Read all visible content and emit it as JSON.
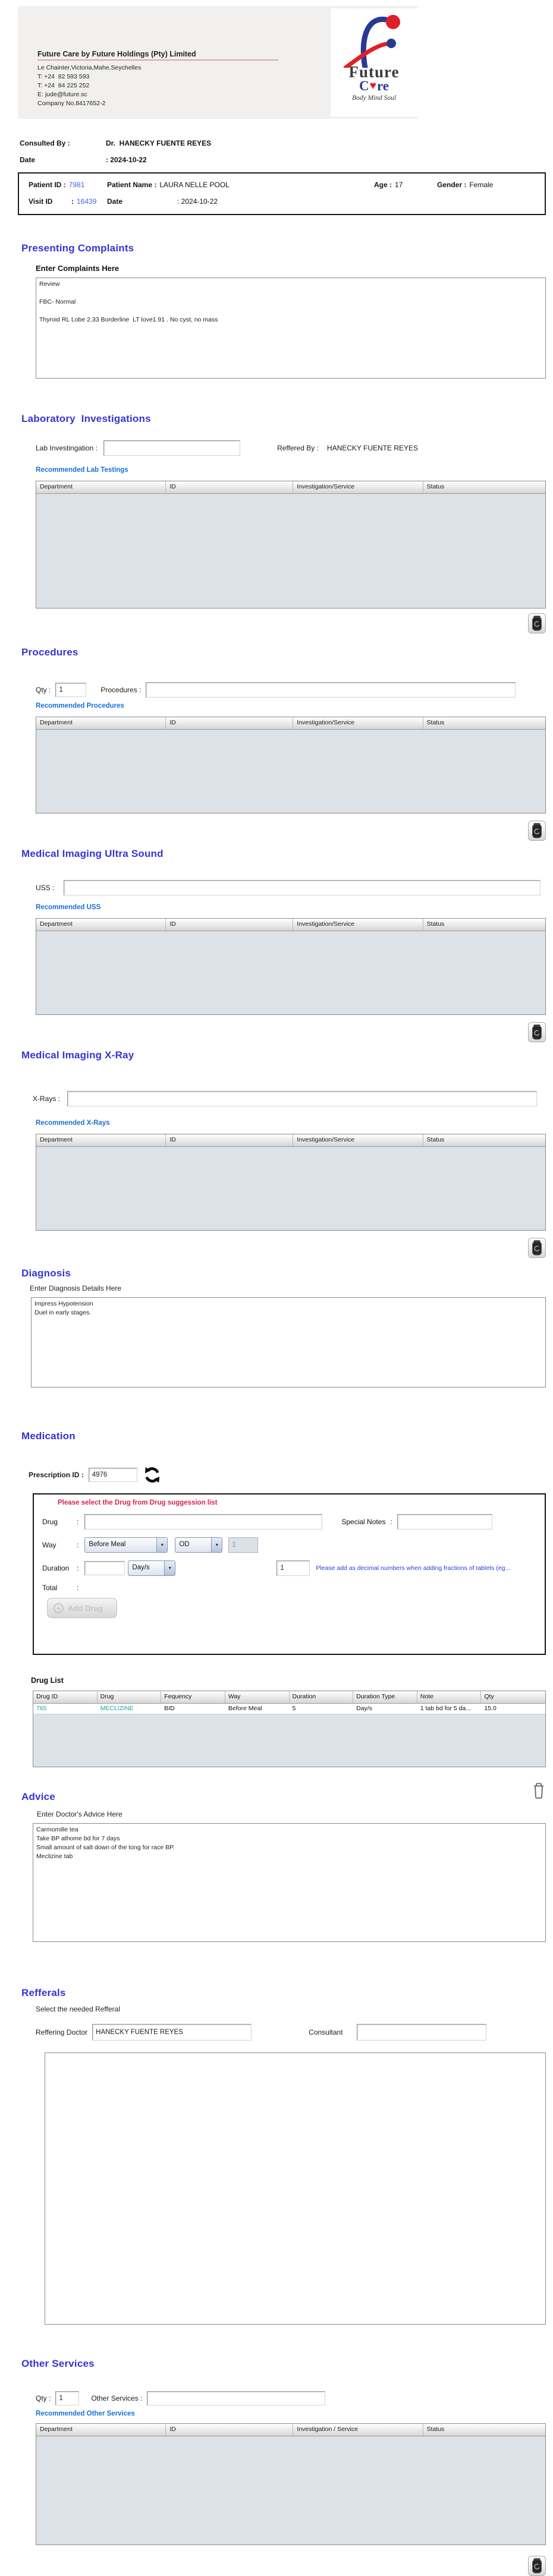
{
  "colon": ":",
  "icons": {
    "dropdown_arrow": "▼",
    "heart": "♥",
    "plus": "+"
  },
  "header": {
    "company_name": "Future Care by Future Holdings (Pty) Limited",
    "address_line": "Le Chainter,Victoria,Mahe,Seychelles",
    "phone1": "T: +24  82 593 593",
    "phone2": "T: +24  84 225 252",
    "email": "E: jude@future.sc",
    "company_no": "Company No.8417652-2",
    "logo_word_future": "Future",
    "logo_word_care_c": "C",
    "logo_word_care_re": "re",
    "logo_tagline": "Body Mind Soul"
  },
  "consultation": {
    "consulted_by_label": "Consulted By :",
    "consulted_by_value": "Dr.  HANECKY FUENTE REYES",
    "date_label": "Date",
    "date_value": ": 2024-10-22"
  },
  "patient": {
    "patient_id_label": "Patient ID :",
    "patient_id": "7981",
    "patient_name_label": "Patient Name :",
    "patient_name": "LAURA NELLE POOL",
    "age_label": "Age :",
    "age": "17",
    "gender_label": "Gender :",
    "gender": "Female",
    "visit_id_label": "Visit ID",
    "visit_id": "16439",
    "visit_date_label": "Date",
    "visit_date_value": ": 2024-10-22"
  },
  "complaints": {
    "title": "Presenting Complaints",
    "sub_label": "Enter Complaints Here",
    "text": "Review\n\nFBC- Normal\n\nThyroid RL Lobe 2.33 Borderline  LT love1.91 . No cyst, no mass"
  },
  "lab": {
    "title": "Laboratory  Investigations",
    "input_label": "Lab Investingation :",
    "input_value": "",
    "referred_by_label": "Reffered By :",
    "referred_by_value": "HANECKY FUENTE REYES",
    "link": "Recommended Lab Testings",
    "headers": [
      "Department",
      "ID",
      "Investigation/Service",
      "Status"
    ]
  },
  "procedures": {
    "title": "Procedures",
    "qty_label": "Qty :",
    "qty_value": "1",
    "input_label": "Procedures :",
    "input_value": "",
    "link": "Recommended Procedures",
    "headers": [
      "Department",
      "ID",
      "Investigation/Service",
      "Status"
    ]
  },
  "uss": {
    "title": "Medical Imaging Ultra Sound",
    "input_label": "USS :",
    "input_value": "",
    "link": "Recommended USS",
    "headers": [
      "Department",
      "ID",
      "Investigation/Service",
      "Status"
    ]
  },
  "xray": {
    "title": "Medical Imaging X-Ray",
    "input_label": "X-Rays :",
    "input_value": "",
    "link": "Recommended X-Rays",
    "headers": [
      "Department",
      "ID",
      "Investigation/Service",
      "Status"
    ]
  },
  "diagnosis": {
    "title": "Diagnosis",
    "sub_label": "Enter Diagnosis Details Here",
    "text": "Impress Hypotension\nDuel in early stages."
  },
  "medication": {
    "title": "Medication",
    "prescription_id_label": "Prescription ID :",
    "prescription_id": "4976",
    "warning": "Please select the Drug from Drug suggession list",
    "drug_label": "Drug",
    "drug_value": "",
    "special_notes_label": "Special Notes",
    "special_notes_value": "",
    "way_label": "Way",
    "way_value": "Before Meal",
    "frequency_value": "OD",
    "way_qty_value": "1",
    "duration_label": "Duration",
    "duration_value": "",
    "duration_unit_value": "Day/s",
    "tablet_qty_value": "1",
    "hint": "Please add as decimal numbers when adding fractions of tablets (eg...",
    "total_label": "Total",
    "add_drug_label": "Add Drug",
    "drug_list_title": "Drug List",
    "table": {
      "headers": [
        "Drug ID",
        "Drug",
        "Fequency",
        "Way",
        "Duration",
        "Duration Type",
        "Note",
        "Qty"
      ],
      "row": [
        "765",
        "MECLIZINE",
        "BID",
        "Before Meal",
        "5",
        "Day/s",
        "1 tab bd for 5 da...",
        "15.0"
      ]
    }
  },
  "advice": {
    "title": "Advice",
    "sub_label": "Enter Doctor's Advice Here",
    "text": "Carmomille tea\nTake BP athome bd for 7 days\nSmall amount of salt down of the tong for race BP.\nMeclizine tab"
  },
  "referrals": {
    "title": "Refferals",
    "sub_label": "Select the needed Refferal",
    "referring_doctor_label": "Reffering Doctor",
    "referring_doctor_value": "HANECKY FUENTE REYES",
    "consultant_label": "Consultant",
    "consultant_value": ""
  },
  "other_services": {
    "title": "Other Services",
    "qty_label": "Qty :",
    "qty_value": "1",
    "input_label": "Other Services :",
    "input_value": "",
    "link": "Recommended Other Services",
    "headers": [
      "Department",
      "ID",
      "Investigation / Service",
      "Status"
    ]
  }
}
